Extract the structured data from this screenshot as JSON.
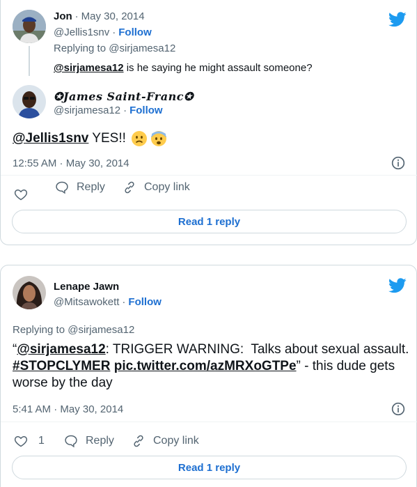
{
  "colors": {
    "accent": "#1d9bf0",
    "link": "#1d6fd1",
    "text": "#0f1419",
    "muted": "#536471",
    "border": "#cfd9de"
  },
  "tweet1": {
    "parent": {
      "name": "Jon",
      "date": "May 30, 2014",
      "handle": "@Jellis1snv",
      "follow": "Follow",
      "replying_to": "Replying to @sirjamesa12",
      "mention": "@sirjamesa12",
      "text": " is he saying he might assault someone?"
    },
    "reply": {
      "name": "✪James Saint-Franc✪",
      "handle": "@sirjamesa12",
      "follow": "Follow",
      "mention": "@Jellis1snv",
      "text": " YES!! ",
      "emojis": [
        "frowning-face",
        "fearful-face"
      ]
    },
    "timestamp": "12:55 AM · May 30, 2014",
    "actions": {
      "like_count": "",
      "reply": "Reply",
      "copy": "Copy link"
    },
    "read_reply": "Read 1 reply",
    "icons": [
      "twitter-bird-icon",
      "info-icon",
      "heart-icon",
      "reply-icon",
      "link-icon"
    ]
  },
  "tweet2": {
    "name": "Lenape Jawn",
    "handle": "@Mitsawokett",
    "follow": "Follow",
    "replying_to": "Replying to @sirjamesa12",
    "text_open": "“",
    "mention": "@sirjamesa12",
    "text_a": ": TRIGGER WARNING:  Talks about sexual assault.  ",
    "hashtag": "#STOPCLYMER",
    "link": "pic.twitter.com/azMRXoGTPe",
    "text_b": "” - this dude gets worse by the day",
    "timestamp": "5:41 AM · May 30, 2014",
    "actions": {
      "like_count": "1",
      "reply": "Reply",
      "copy": "Copy link"
    },
    "read_reply": "Read 1 reply"
  }
}
